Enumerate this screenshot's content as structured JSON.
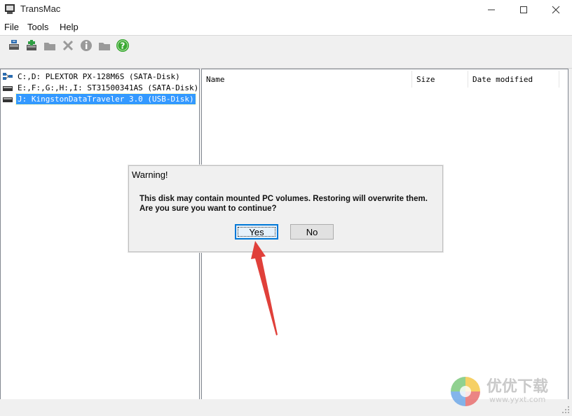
{
  "window": {
    "title": "TransMac",
    "controls": [
      "minimize-icon",
      "maximize-icon",
      "close-icon"
    ]
  },
  "menu": {
    "items": [
      {
        "label": "File"
      },
      {
        "label": "Tools"
      },
      {
        "label": "Help"
      }
    ]
  },
  "toolbar": {
    "icons": [
      "restore-disk-icon",
      "save-disk-icon",
      "folder-icon",
      "delete-icon",
      "info-icon",
      "open-folder-icon",
      "help-icon"
    ]
  },
  "tree": {
    "items": [
      {
        "label": "C:,D: PLEXTOR PX-128M6S (SATA-Disk)",
        "icon": "computer-icon",
        "selected": false
      },
      {
        "label": "E:,F:,G:,H:,I: ST31500341AS (SATA-Disk)",
        "icon": "drive-icon",
        "selected": false
      },
      {
        "label": "J: KingstonDataTraveler 3.0 (USB-Disk)",
        "icon": "usb-drive-icon",
        "selected": true
      }
    ]
  },
  "file_list": {
    "columns": [
      {
        "label": "Name"
      },
      {
        "label": "Size"
      },
      {
        "label": "Date modified"
      }
    ]
  },
  "dialog": {
    "title": "Warning!",
    "message_line1": "This disk may contain mounted PC volumes. Restoring will overwrite them.",
    "message_line2": "Are you sure you want to continue?",
    "yes_label": "Yes",
    "no_label": "No"
  },
  "watermark": {
    "text": "优优下载",
    "url": "www.yyxt.com"
  },
  "colors": {
    "selection": "#3399ff",
    "arrow": "#e0403a",
    "help_green": "#3aa832"
  }
}
